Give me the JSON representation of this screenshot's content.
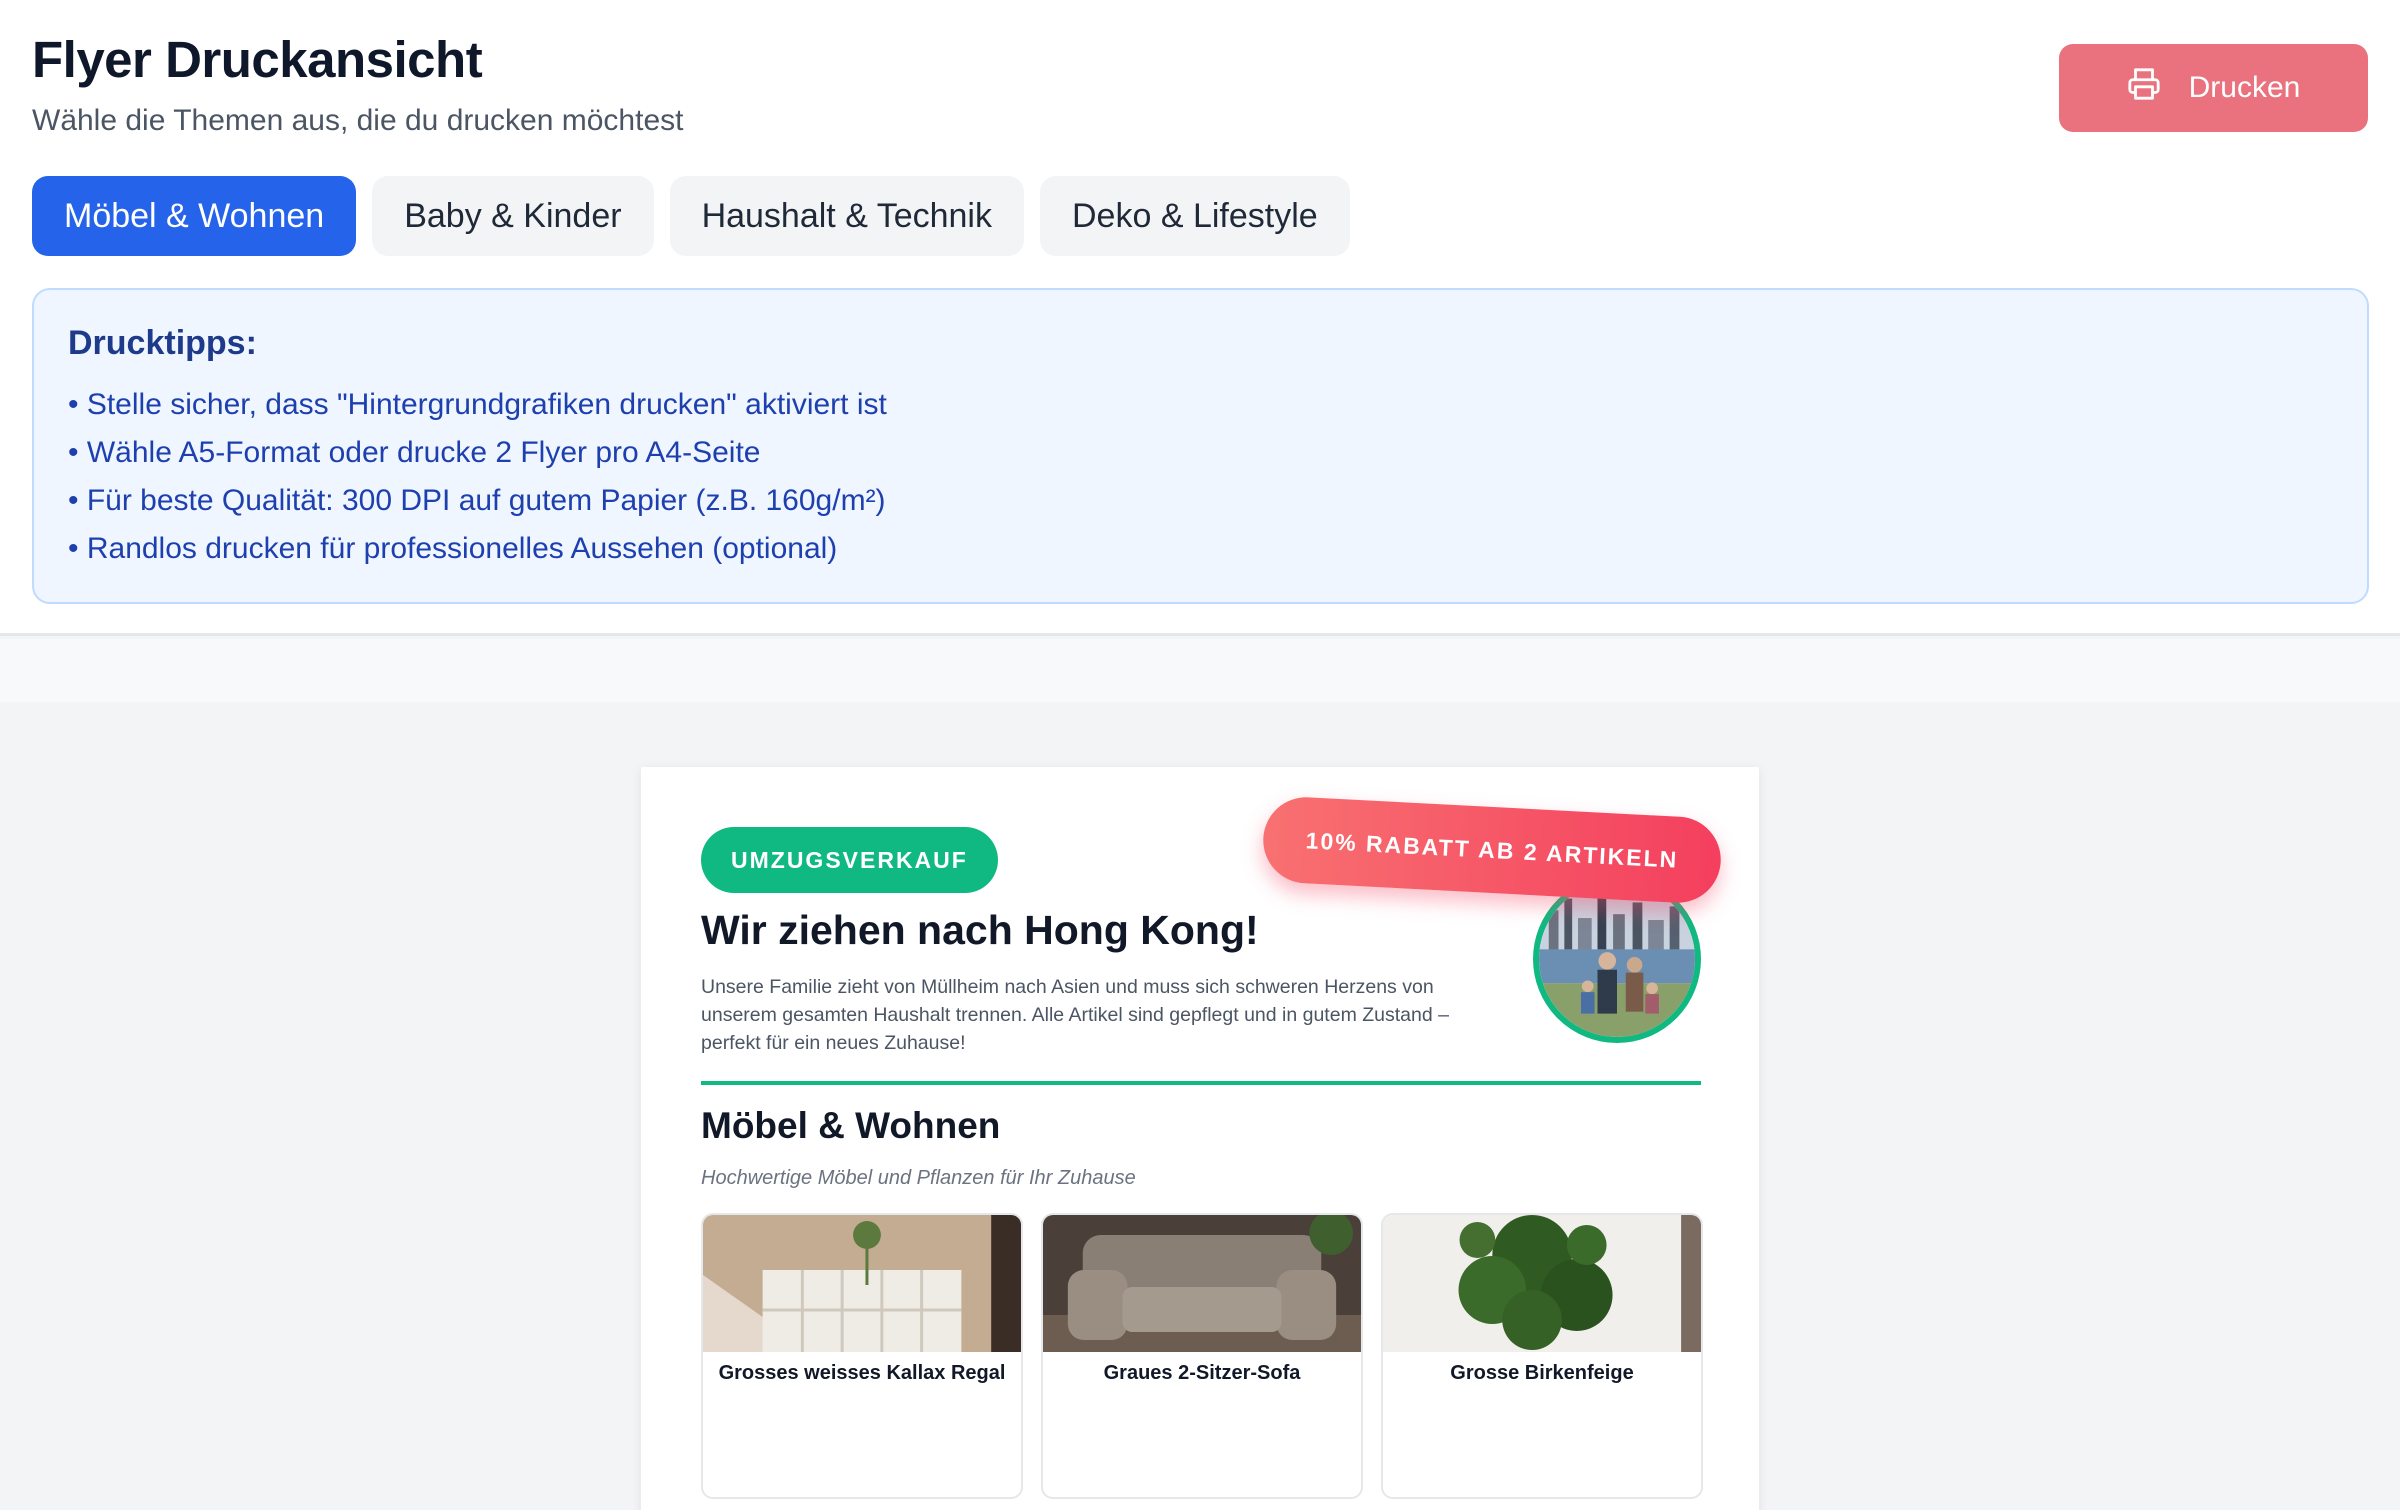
{
  "header": {
    "title": "Flyer Druckansicht",
    "subtitle": "Wähle die Themen aus, die du drucken möchtest",
    "print_label": "Drucken",
    "print_icon": "printer-icon"
  },
  "tabs": [
    {
      "label": "Möbel & Wohnen",
      "active": true
    },
    {
      "label": "Baby & Kinder",
      "active": false
    },
    {
      "label": "Haushalt & Technik",
      "active": false
    },
    {
      "label": "Deko & Lifestyle",
      "active": false
    }
  ],
  "tips": {
    "title": "Drucktipps:",
    "items": [
      "• Stelle sicher, dass \"Hintergrundgrafiken drucken\" aktiviert ist",
      "• Wähle A5-Format oder drucke 2 Flyer pro A4-Seite",
      "• Für beste Qualität: 300 DPI auf gutem Papier (z.B. 160g/m²)",
      "• Randlos drucken für professionelles Aussehen (optional)"
    ]
  },
  "flyer": {
    "badge": "UMZUGSVERKAUF",
    "ribbon": "10% RABATT AB 2 ARTIKELN",
    "headline": "Wir ziehen nach Hong Kong!",
    "intro": "Unsere Familie zieht von Müllheim nach Asien und muss sich schweren Herzens von unserem gesamten Haushalt trennen. Alle Artikel sind gepflegt und in gutem Zustand – perfekt für ein neues Zuhause!",
    "section_title": "Möbel & Wohnen",
    "section_subtitle": "Hochwertige Möbel und Pflanzen für Ihr Zuhause",
    "items": [
      {
        "name": "Grosses weisses Kallax Regal"
      },
      {
        "name": "Graues 2-Sitzer-Sofa"
      },
      {
        "name": "Grosse Birkenfeige"
      }
    ]
  },
  "colors": {
    "accent": "#2563eb",
    "print_button": "#e9727e",
    "badge_green": "#10b981",
    "ribbon": "#f43f5e",
    "tips_bg": "#eff6ff",
    "tips_text": "#1e40af"
  }
}
